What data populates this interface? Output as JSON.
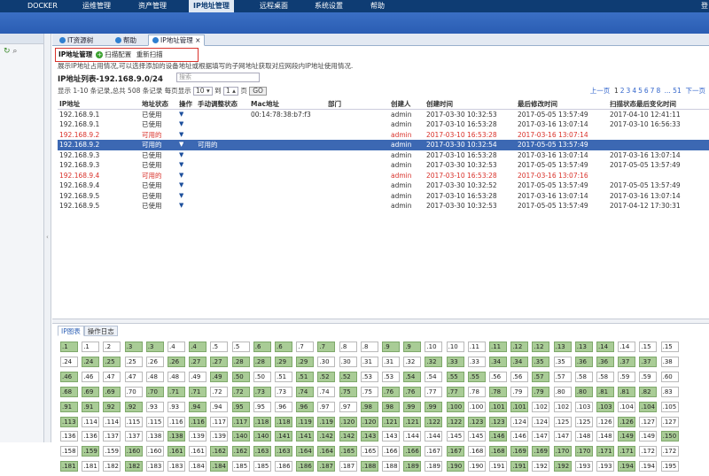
{
  "nav": {
    "items": [
      "DOCKER",
      "运维管理",
      "资产管理",
      "IP地址管理",
      "远程桌面",
      "系统设置",
      "帮助"
    ],
    "active_index": 3,
    "right": "登"
  },
  "tabs": [
    {
      "label": "IT资源树"
    },
    {
      "label": "帮助"
    },
    {
      "label": "IP地址管理"
    }
  ],
  "tab_close": "×",
  "toolbar": {
    "title": "IP地址管理",
    "scan_config": "扫描配置",
    "rescan": "重新扫描"
  },
  "description": "展示IP地址占用情况,可以选择添加的设备地址或根据填写的子网地址获取对应网段内IP地址使用情况.",
  "list": {
    "title": "IP地址列表-192.168.9.0/24",
    "search_placeholder": "搜索"
  },
  "pager": {
    "summary": "显示 1-10 条记录,总共 508 条记录 每页显示",
    "per_page": "10",
    "to": "到",
    "page_input": "1",
    "page_unit": "页",
    "go": "GO",
    "prev": "上一页",
    "pages": [
      "1",
      "2",
      "3",
      "4",
      "5",
      "6",
      "7",
      "8"
    ],
    "ellipsis": "...",
    "last": "51",
    "next": "下一页",
    "current_page": "1"
  },
  "columns": [
    "IP地址",
    "地址状态",
    "操作",
    "手动调整状态",
    "Mac地址",
    "部门",
    "创建人",
    "创建时间",
    "最后修改时间",
    "扫描状态最后变化时间"
  ],
  "rows": [
    {
      "ip": "192.168.9.1",
      "status": "已使用",
      "manual": "",
      "mac": "00:14:78:38:b7:f3",
      "dept": "",
      "creator": "admin",
      "created": "2017-03-30 10:32:53",
      "modified": "2017-05-05 13:57:49",
      "scan": "2017-04-10 12:41:11",
      "cls": ""
    },
    {
      "ip": "192.168.9.1",
      "status": "已使用",
      "manual": "",
      "mac": "",
      "dept": "",
      "creator": "admin",
      "created": "2017-03-10 16:53:28",
      "modified": "2017-03-16 13:07:14",
      "scan": "2017-03-10 16:56:33",
      "cls": ""
    },
    {
      "ip": "192.168.9.2",
      "status": "可用的",
      "manual": "",
      "mac": "",
      "dept": "",
      "creator": "admin",
      "created": "2017-03-10 16:53:28",
      "modified": "2017-03-16 13:07:14",
      "scan": "",
      "cls": "red"
    },
    {
      "ip": "192.168.9.2",
      "status": "可用的",
      "manual": "可用的",
      "mac": "",
      "dept": "",
      "creator": "admin",
      "created": "2017-03-30 10:32:54",
      "modified": "2017-05-05 13:57:49",
      "scan": "",
      "cls": "sel"
    },
    {
      "ip": "192.168.9.3",
      "status": "已使用",
      "manual": "",
      "mac": "",
      "dept": "",
      "creator": "admin",
      "created": "2017-03-10 16:53:28",
      "modified": "2017-03-16 13:07:14",
      "scan": "2017-03-16 13:07:14",
      "cls": ""
    },
    {
      "ip": "192.168.9.3",
      "status": "已使用",
      "manual": "",
      "mac": "",
      "dept": "",
      "creator": "admin",
      "created": "2017-03-30 10:32:53",
      "modified": "2017-05-05 13:57:49",
      "scan": "2017-05-05 13:57:49",
      "cls": ""
    },
    {
      "ip": "192.168.9.4",
      "status": "可用的",
      "manual": "",
      "mac": "",
      "dept": "",
      "creator": "admin",
      "created": "2017-03-10 16:53:28",
      "modified": "2017-03-16 13:07:16",
      "scan": "",
      "cls": "red"
    },
    {
      "ip": "192.168.9.4",
      "status": "已使用",
      "manual": "",
      "mac": "",
      "dept": "",
      "creator": "admin",
      "created": "2017-03-30 10:32:52",
      "modified": "2017-05-05 13:57:49",
      "scan": "2017-05-05 13:57:49",
      "cls": ""
    },
    {
      "ip": "192.168.9.5",
      "status": "已使用",
      "manual": "",
      "mac": "",
      "dept": "",
      "creator": "admin",
      "created": "2017-03-10 16:53:28",
      "modified": "2017-03-16 13:07:14",
      "scan": "2017-03-16 13:07:14",
      "cls": ""
    },
    {
      "ip": "192.168.9.5",
      "status": "已使用",
      "manual": "",
      "mac": "",
      "dept": "",
      "creator": "admin",
      "created": "2017-03-30 10:32:53",
      "modified": "2017-05-05 13:57:49",
      "scan": "2017-04-12 17:30:31",
      "cls": ""
    }
  ],
  "bottom_tabs": [
    "IP图表",
    "操作日志"
  ],
  "ip_grid": {
    "cells": [
      ".1",
      ".1",
      ".2",
      ".3",
      ".3",
      ".4",
      ".4",
      ".5",
      ".5",
      ".6",
      ".6",
      ".7",
      ".7",
      ".8",
      ".8",
      ".9",
      ".9",
      ".10",
      ".10",
      ".11",
      ".11",
      ".12",
      ".12",
      ".13",
      ".13",
      ".14",
      ".14",
      ".15",
      ".15",
      ".24",
      ".24",
      ".25",
      ".25",
      ".26",
      ".26",
      ".27",
      ".27",
      ".28",
      ".28",
      ".29",
      ".29",
      ".30",
      ".30",
      ".31",
      ".31",
      ".32",
      ".32",
      ".33",
      ".33",
      ".34",
      ".34",
      ".35",
      ".35",
      ".36",
      ".36",
      ".37",
      ".37",
      ".38",
      ".46",
      ".46",
      ".47",
      ".47",
      ".48",
      ".48",
      ".49",
      ".49",
      ".50",
      ".50",
      ".51",
      ".51",
      ".52",
      ".52",
      ".53",
      ".53",
      ".54",
      ".54",
      ".55",
      ".55",
      ".56",
      ".56",
      ".57",
      ".57",
      ".58",
      ".58",
      ".59",
      ".59",
      ".60",
      ".68",
      ".69",
      ".69",
      ".70",
      ".70",
      ".71",
      ".71",
      ".72",
      ".72",
      ".73",
      ".73",
      ".74",
      ".74",
      ".75",
      ".75",
      ".76",
      ".76",
      ".77",
      ".77",
      ".78",
      ".78",
      ".79",
      ".79",
      ".80",
      ".80",
      ".81",
      ".81",
      ".82",
      ".83",
      ".91",
      ".91",
      ".92",
      ".92",
      ".93",
      ".93",
      ".94",
      ".94",
      ".95",
      ".95",
      ".96",
      ".96",
      ".97",
      ".97",
      ".98",
      ".98",
      ".99",
      ".99",
      ".100",
      ".100",
      ".101",
      ".101",
      ".102",
      ".102",
      ".103",
      ".103",
      ".104",
      ".104",
      ".105",
      ".113",
      ".114",
      ".114",
      ".115",
      ".115",
      ".116",
      ".116",
      ".117",
      ".117",
      ".118",
      ".118",
      ".119",
      ".119",
      ".120",
      ".120",
      ".121",
      ".121",
      ".122",
      ".122",
      ".123",
      ".123",
      ".124",
      ".124",
      ".125",
      ".125",
      ".126",
      ".126",
      ".127",
      ".127",
      ".136",
      ".136",
      ".137",
      ".137",
      ".138",
      ".138",
      ".139",
      ".139",
      ".140",
      ".140",
      ".141",
      ".141",
      ".142",
      ".142",
      ".143",
      ".143",
      ".144",
      ".144",
      ".145",
      ".145",
      ".146",
      ".146",
      ".147",
      ".147",
      ".148",
      ".148",
      ".149",
      ".149",
      ".150",
      ".158",
      ".159",
      ".159",
      ".160",
      ".160",
      ".161",
      ".161",
      ".162",
      ".162",
      ".163",
      ".163",
      ".164",
      ".164",
      ".165",
      ".165",
      ".166",
      ".166",
      ".167",
      ".167",
      ".168",
      ".168",
      ".169",
      ".169",
      ".170",
      ".170",
      ".171",
      ".171",
      ".172",
      ".172",
      ".181",
      ".181",
      ".182",
      ".182",
      ".183",
      ".183",
      ".184",
      ".184",
      ".185",
      ".185",
      ".186",
      ".186",
      ".187",
      ".187",
      ".188",
      ".188",
      ".189",
      ".189",
      ".190",
      ".190",
      ".191",
      ".191",
      ".192",
      ".192",
      ".193",
      ".193",
      ".194",
      ".194",
      ".195"
    ],
    "used": [
      0,
      3,
      4,
      6,
      9,
      10,
      12,
      15,
      16,
      20,
      21,
      22,
      23,
      24,
      25,
      30,
      31,
      34,
      35,
      36,
      37,
      38,
      39,
      40,
      46,
      47,
      49,
      50,
      51,
      53,
      54,
      55,
      56,
      58,
      65,
      66,
      69,
      70,
      71,
      74,
      76,
      77,
      80,
      87,
      88,
      89,
      91,
      92,
      93,
      95,
      96,
      98,
      100,
      102,
      103,
      105,
      107,
      109,
      111,
      112,
      113,
      114,
      116,
      117,
      118,
      119,
      122,
      124,
      127,
      130,
      131,
      132,
      133,
      134,
      136,
      137,
      141,
      143,
      145,
      151,
      153,
      154,
      155,
      156,
      157,
      158,
      159,
      160,
      161,
      162,
      163,
      164,
      165,
      171,
      179,
      182,
      183,
      184,
      185,
      186,
      187,
      188,
      194,
      200,
      202,
      204,
      206,
      208,
      210,
      211,
      212,
      213,
      214,
      215,
      216,
      219,
      221,
      223,
      224,
      225,
      226,
      227,
      228,
      229,
      232,
      235,
      239,
      243,
      244,
      246,
      248,
      250,
      253,
      255,
      258,
      261
    ]
  }
}
